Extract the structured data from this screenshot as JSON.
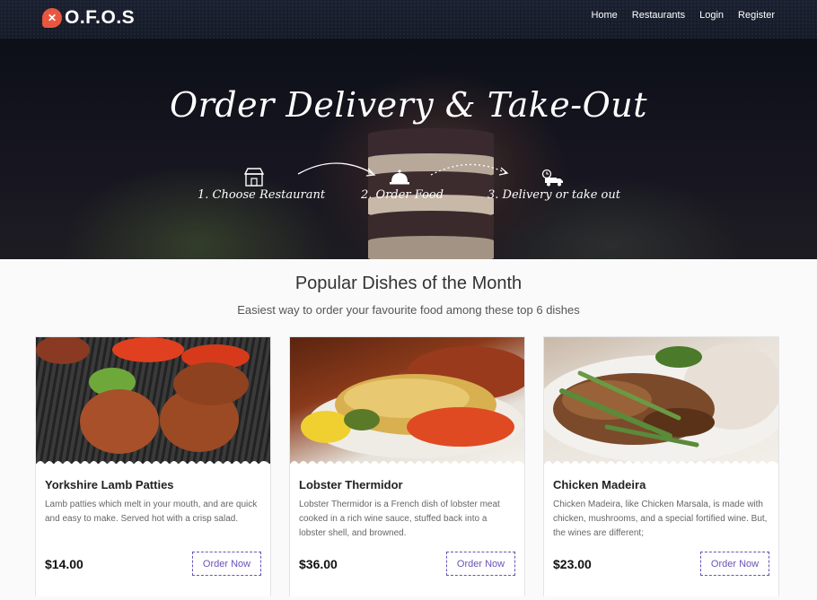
{
  "brand": {
    "name": "O.F.O.S",
    "badge_icon": "utensils-icon",
    "badge_color": "#e8553e"
  },
  "nav": {
    "links": [
      "Home",
      "Restaurants",
      "Login",
      "Register"
    ]
  },
  "hero": {
    "title": "Order Delivery & Take-Out",
    "steps": [
      {
        "icon": "store-icon",
        "label": "1. Choose Restaurant"
      },
      {
        "icon": "cloche-icon",
        "label": "2. Order Food"
      },
      {
        "icon": "delivery-truck-icon",
        "label": "3. Delivery or take out"
      }
    ]
  },
  "section": {
    "title": "Popular Dishes of the Month",
    "subtitle": "Easiest way to order your favourite food among these top 6 dishes"
  },
  "accent": "#6b52b8",
  "dishes": [
    {
      "name": "Yorkshire Lamb Patties",
      "description": "Lamb patties which melt in your mouth, and are quick and easy to make. Served hot with a crisp salad.",
      "price": "$14.00",
      "button": "Order Now"
    },
    {
      "name": "Lobster Thermidor",
      "description": "Lobster Thermidor is a French dish of lobster meat cooked in a rich wine sauce, stuffed back into a lobster shell, and browned.",
      "price": "$36.00",
      "button": "Order Now"
    },
    {
      "name": "Chicken Madeira",
      "description": "Chicken Madeira, like Chicken Marsala, is made with chicken, mushrooms, and a special fortified wine. But, the wines are different;",
      "price": "$23.00",
      "button": "Order Now"
    }
  ]
}
